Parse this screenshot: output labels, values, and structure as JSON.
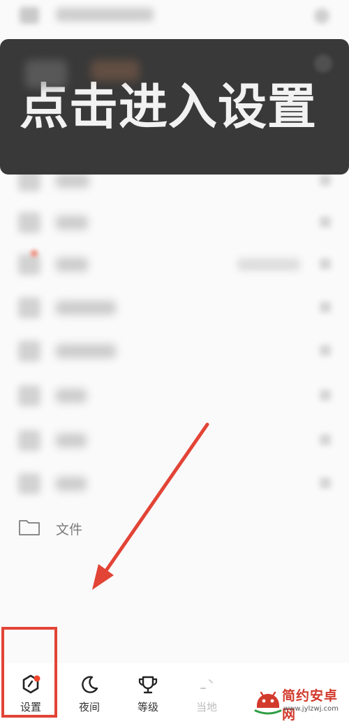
{
  "callout": {
    "text": "点击进入设置"
  },
  "files": {
    "label": "文件"
  },
  "bottom_nav": {
    "tabs": [
      {
        "label": "设置",
        "icon": "settings-hexagon-icon",
        "has_badge": true
      },
      {
        "label": "夜间",
        "icon": "moon-icon"
      },
      {
        "label": "等级",
        "icon": "trophy-icon"
      },
      {
        "label": "当地",
        "icon": "location-icon"
      }
    ]
  },
  "watermark": {
    "name": "简约安卓网",
    "url": "www.jylzwj.com"
  },
  "colors": {
    "accent": "#e24436",
    "badge": "#f0442c",
    "overlay": "#2a2a2a"
  }
}
